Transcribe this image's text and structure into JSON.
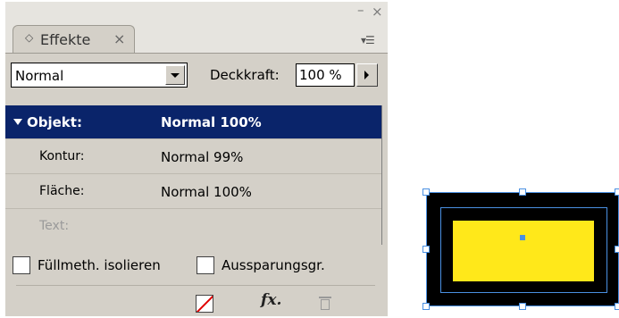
{
  "panel": {
    "tab_label": "Effekte",
    "tab_close": "×",
    "minimize": "–",
    "close": "×",
    "menu_icon": "panel-menu-icon"
  },
  "blend": {
    "mode": "Normal",
    "opacity_label": "Deckkraft:",
    "opacity_value": "100 %"
  },
  "effects": [
    {
      "name": "Objekt:",
      "value": "Normal 100%",
      "selected": true
    },
    {
      "name": "Kontur:",
      "value": "Normal 99%"
    },
    {
      "name": "Fläche:",
      "value": "Normal 100%"
    },
    {
      "name": "Text:",
      "value": "",
      "disabled": true
    }
  ],
  "options": {
    "isolate_blending": "Füllmeth. isolieren",
    "knockout_group": "Aussparungsgr."
  },
  "buttons": {
    "clear_effects": "clear-effects-icon",
    "fx": "fx",
    "fx_suffix": ".",
    "delete": "trash-icon"
  },
  "colors": {
    "selection": "#0a246a",
    "object_fill": "#ffe81a",
    "object_stroke": "#000000",
    "frame": "#4a90e2"
  }
}
